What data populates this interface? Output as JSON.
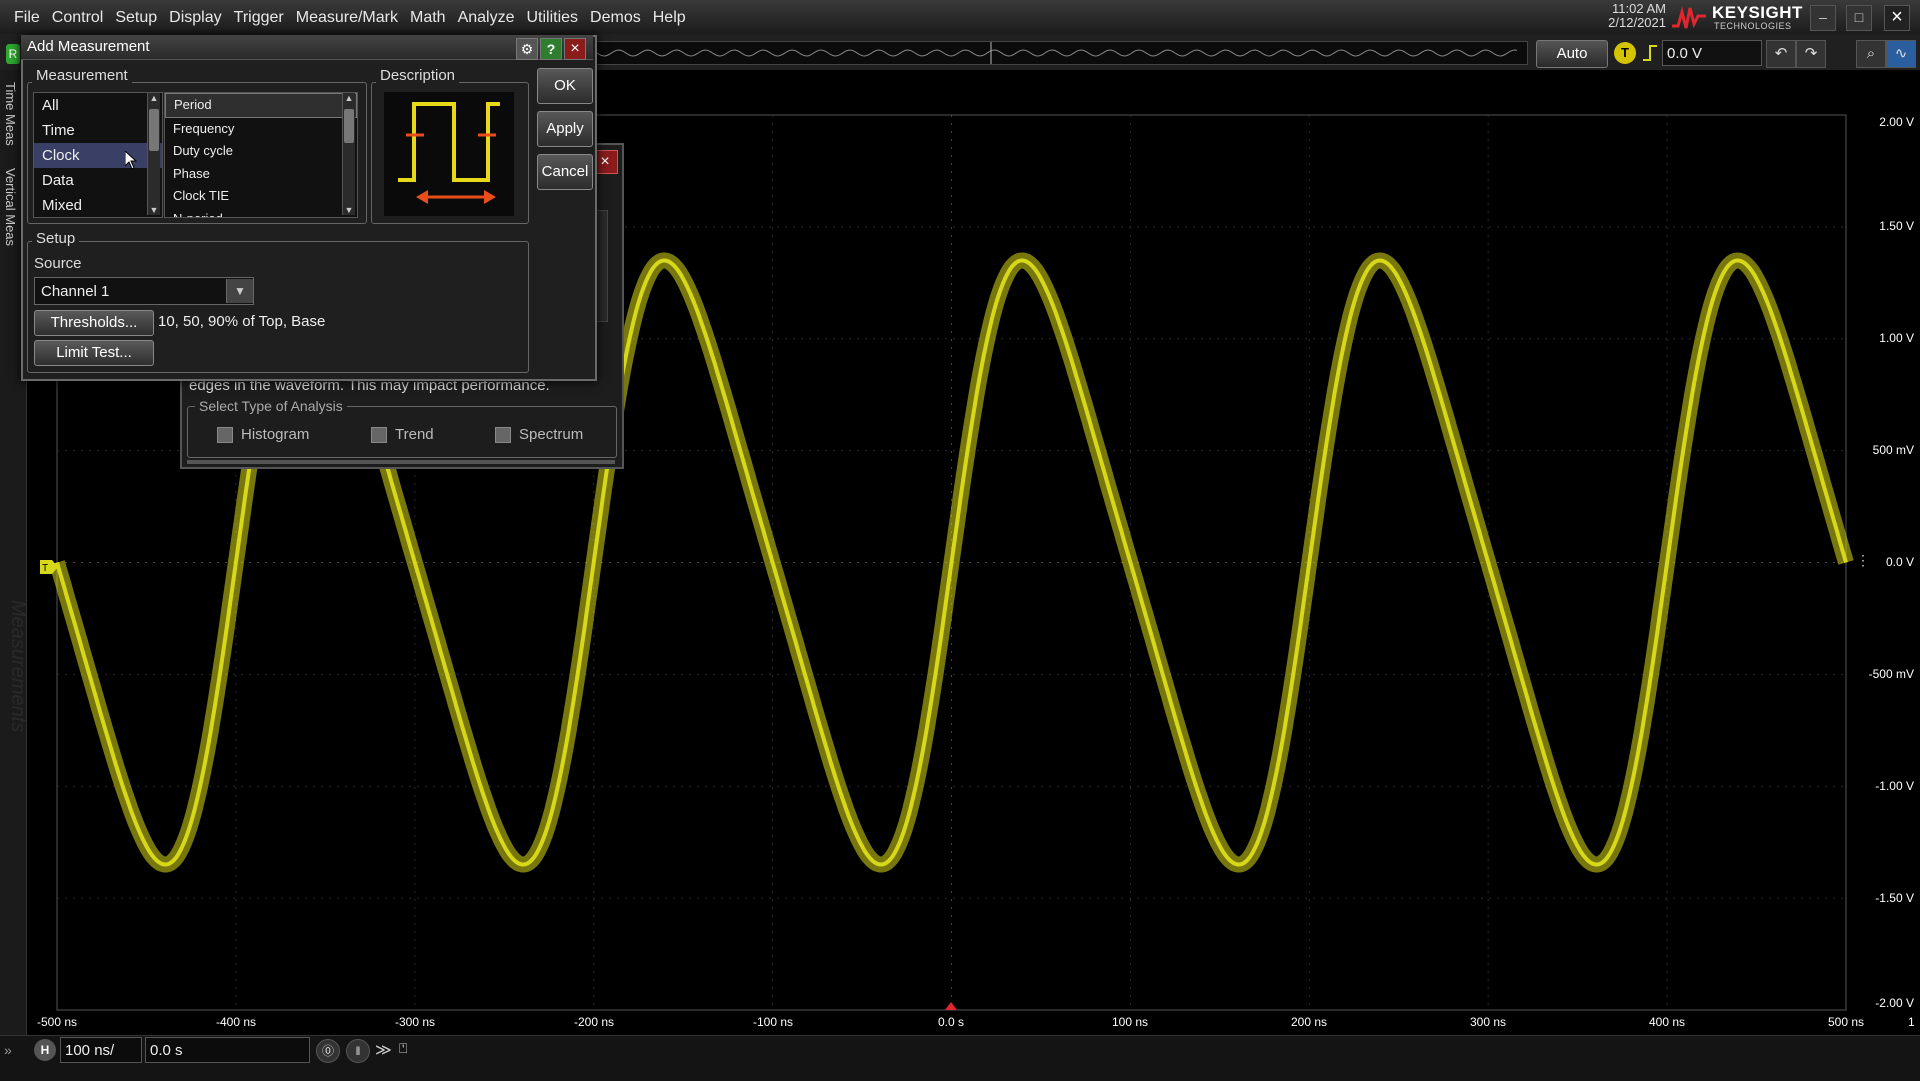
{
  "menu": [
    "File",
    "Control",
    "Setup",
    "Display",
    "Trigger",
    "Measure/Mark",
    "Math",
    "Analyze",
    "Utilities",
    "Demos",
    "Help"
  ],
  "header": {
    "time": "11:02 AM",
    "date": "2/12/2021",
    "brand": "KEYSIGHT",
    "brand_sub": "TECHNOLOGIES",
    "auto_label": "Auto",
    "trigger_indicator": "T",
    "trigger_level": "0.0 V",
    "run_indicator": "R"
  },
  "left_tabs": {
    "time_meas": "Time Meas",
    "vertical_meas": "Vertical Meas",
    "measurements": "Measurements"
  },
  "dialog": {
    "title": "Add Measurement",
    "measurement_group": "Measurement",
    "categories": [
      "All",
      "Time",
      "Clock",
      "Data",
      "Mixed"
    ],
    "selected_category": "Clock",
    "measurements": [
      "Period",
      "Frequency",
      "Duty cycle",
      "Phase",
      "Clock TIE",
      "N-period"
    ],
    "selected_measurement": "Period",
    "description_group": "Description",
    "buttons": {
      "ok": "OK",
      "apply": "Apply",
      "cancel": "Cancel"
    },
    "setup_group": "Setup",
    "source_label": "Source",
    "source_value": "Channel 1",
    "thresholds_button": "Thresholds...",
    "thresholds_value": "10, 50, 90% of Top, Base",
    "limit_test_button": "Limit Test..."
  },
  "back_dialog": {
    "text": "edges in the waveform. This may impact performance.",
    "analysis_group": "Select Type of Analysis",
    "options": [
      "Histogram",
      "Trend",
      "Spectrum"
    ]
  },
  "scope": {
    "y_labels": [
      "2.00 V",
      "1.50 V",
      "1.00 V",
      "500 mV",
      "0.0 V",
      "-500 mV",
      "-1.00 V",
      "-1.50 V",
      "-2.00 V"
    ],
    "x_labels": [
      "-500 ns",
      "-400 ns",
      "-300 ns",
      "-200 ns",
      "-100 ns",
      "0.0 s",
      "100 ns",
      "200 ns",
      "300 ns",
      "400 ns",
      "500 ns"
    ],
    "channel_color": "#d8d81a",
    "trace_amplitude_v": 1.35,
    "trace_period_ns": 200,
    "corner_label": "1"
  },
  "timebase": {
    "h_label": "H",
    "scale": "100 ns/",
    "position": "0.0 s"
  }
}
